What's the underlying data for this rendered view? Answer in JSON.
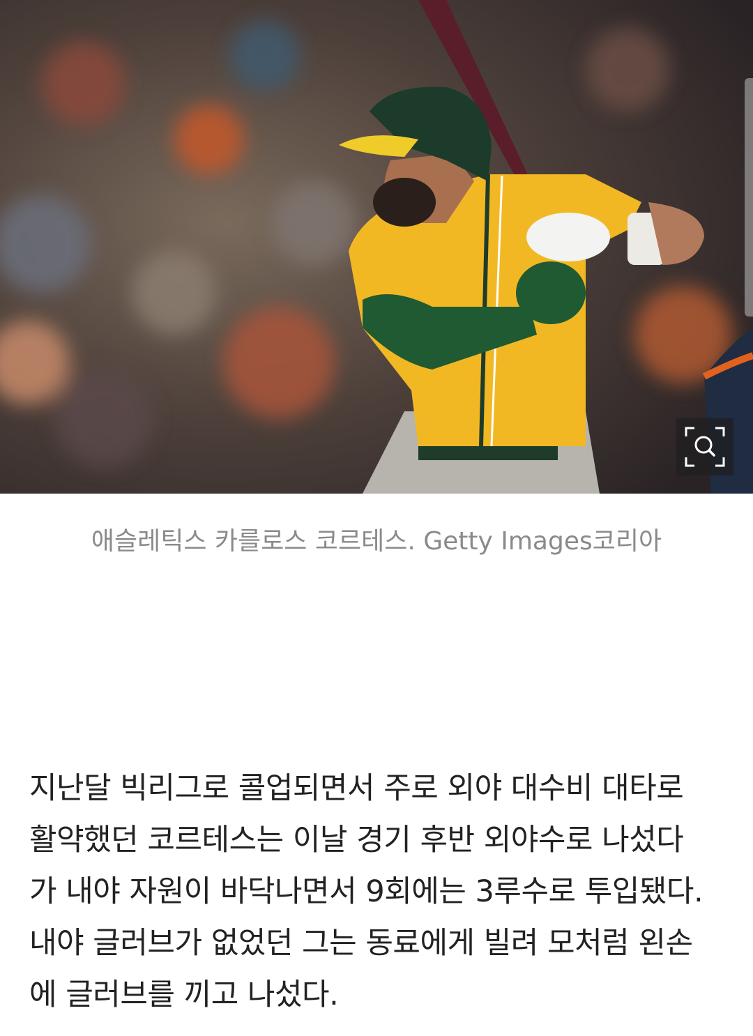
{
  "photo": {
    "alt": "애슬레틱스 카를로스 코르테스",
    "zoom_icon": "zoom-magnifier-icon"
  },
  "caption": "애슬레틱스 카를로스 코르테스. Getty Images코리아",
  "article": {
    "lines": [
      "지난달 빅리그로 콜업되면서 주로 외야 대수비 대타로",
      "활약했던 코르테스는 이날 경기 후반 외야수로 나섰다",
      "가 내야 자원이 바닥나면서 9회에는 3루수로 투입됐다.",
      "내야 글러브가 없었던 그는 동료에게 빌려 모처럼 왼손",
      "에 글러브를 끼고 나섰다."
    ]
  },
  "colors": {
    "jersey_yellow": "#f2b823",
    "helmet_green": "#1d3b2a",
    "caption_gray": "#8a8a8a",
    "text_dark": "#222222"
  }
}
